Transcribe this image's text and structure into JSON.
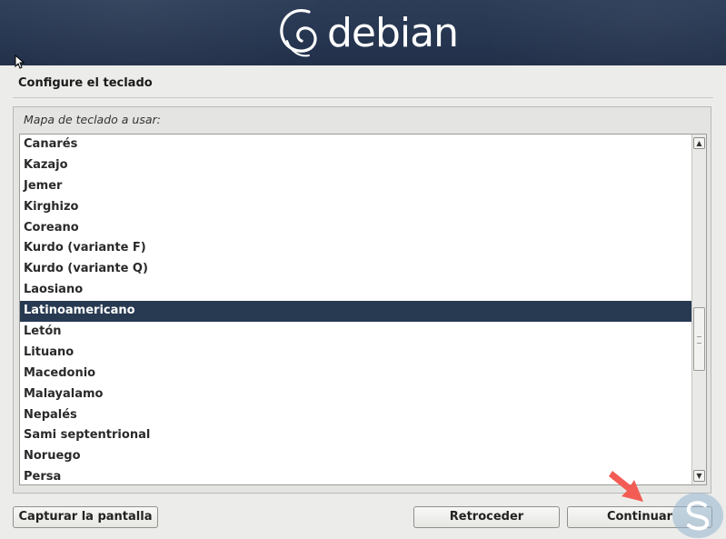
{
  "banner": {
    "logo_text": "debian"
  },
  "page": {
    "title": "Configure el teclado"
  },
  "keymap": {
    "label": "Mapa de teclado a usar:",
    "items": [
      "Canarés",
      "Kazajo",
      "Jemer",
      "Kirghizo",
      "Coreano",
      "Kurdo (variante F)",
      "Kurdo (variante Q)",
      "Laosiano",
      "Latinoamericano",
      "Letón",
      "Lituano",
      "Macedonio",
      "Malayalamo",
      "Nepalés",
      "Sami septentrional",
      "Noruego",
      "Persa"
    ],
    "selected": "Latinoamericano"
  },
  "buttons": {
    "capture": "Capturar la pantalla",
    "back": "Retroceder",
    "continue": "Continuar"
  },
  "colors": {
    "banner": "#283652",
    "selection": "#283a52",
    "annotation_arrow": "#f25c54"
  },
  "icons": {
    "logo": "debian-swirl-icon",
    "cursor": "mouse-pointer-icon",
    "scroll_up": "chevron-up-icon",
    "scroll_down": "chevron-down-icon",
    "annotation": "red-arrow-icon",
    "watermark": "watermark-logo-icon"
  }
}
